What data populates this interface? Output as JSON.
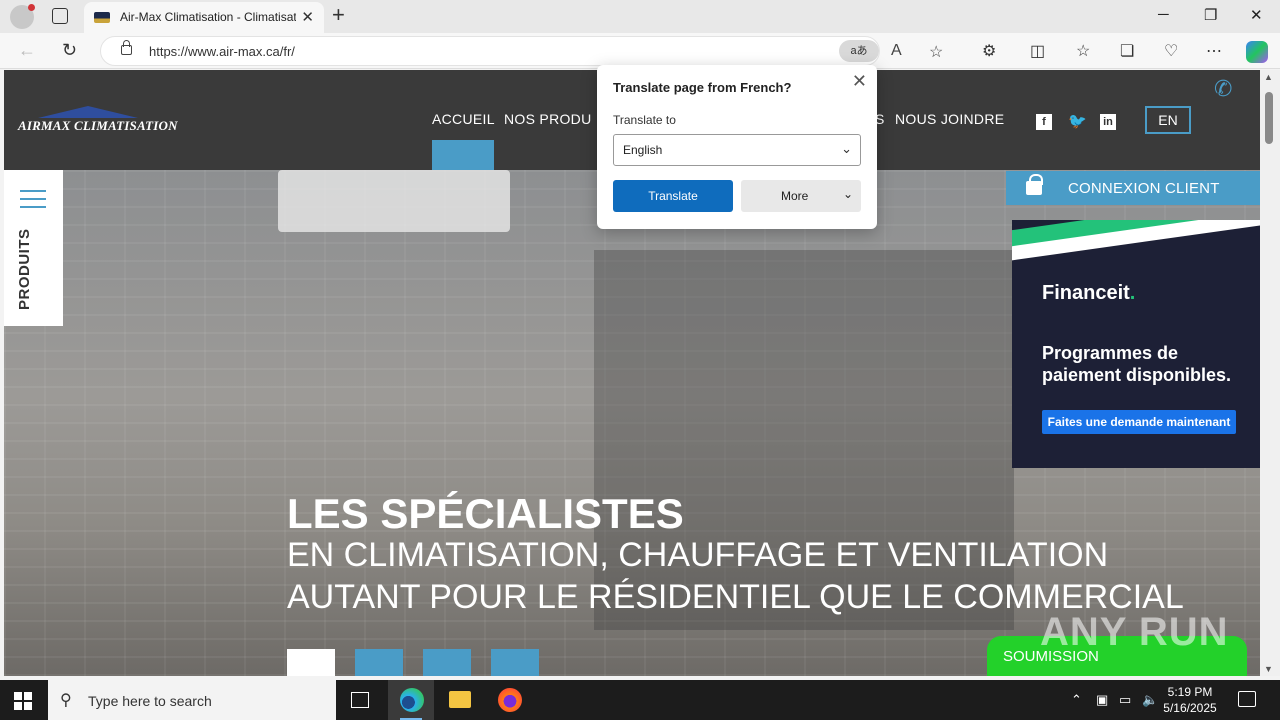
{
  "browser": {
    "tab_title": "Air-Max Climatisation - Climatisation",
    "url": "https://www.air-max.ca/fr/",
    "translate_icon_label": "aあ"
  },
  "site": {
    "logo_text": "AIRMAX CLIMATISATION",
    "menu": [
      "ACCUEIL",
      "NOS PRODU",
      "S",
      "NOUS JOINDRE"
    ],
    "lang_button": "EN",
    "sidebar_label": "PRODUITS",
    "connexion_label": "CONNEXION CLIENT",
    "hero": {
      "title": "LES SPÉCIALISTES",
      "line1": "EN CLIMATISATION, CHAUFFAGE ET VENTILATION",
      "line2": "AUTANT POUR LE RÉSIDENTIEL QUE LE COMMERCIAL",
      "slide_count": 4,
      "active_slide": 1
    },
    "ad": {
      "brand": "Financeit",
      "brand_dot": ".",
      "text": "Programmes de paiement disponibles.",
      "button": "Faites une demande maintenant"
    },
    "soumission_label": "SOUMISSION",
    "watermark": "ANY RUN"
  },
  "translate_popup": {
    "title": "Translate page from French?",
    "subtitle": "Translate to",
    "selected_language": "English",
    "translate_button": "Translate",
    "more_button": "More"
  },
  "taskbar": {
    "search_placeholder": "Type here to search",
    "time": "5:19 PM",
    "date": "5/16/2025"
  },
  "colors": {
    "accent_blue": "#4a9cc7",
    "header_dark": "#3a3a3a",
    "translate_blue": "#0f6cbd",
    "financeit_green": "#23c27a",
    "soumission_green": "#23d12a"
  }
}
